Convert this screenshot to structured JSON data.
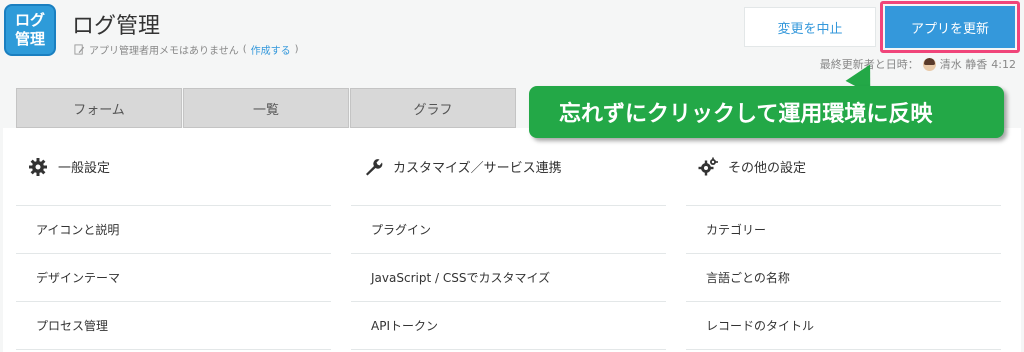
{
  "app": {
    "icon_line1": "ログ",
    "icon_line2": "管理",
    "title": "ログ管理"
  },
  "memo": {
    "text": "アプリ管理者用メモはありません",
    "link_open": "(",
    "link": "作成する",
    "link_close": ")"
  },
  "header": {
    "cancel_label": "変更を中止",
    "update_label": "アプリを更新",
    "last_updated_label": "最終更新者と日時：",
    "last_updated_user": "清水 静香",
    "last_updated_time": "4:12"
  },
  "tabs": [
    {
      "label": "フォーム"
    },
    {
      "label": "一覧"
    },
    {
      "label": "グラフ"
    }
  ],
  "callout": {
    "text": "忘れずにクリックして運用環境に反映"
  },
  "columns": [
    {
      "icon": "gear-icon",
      "title": "一般設定",
      "items": [
        "アイコンと説明",
        "デザインテーマ",
        "プロセス管理"
      ]
    },
    {
      "icon": "wrench-icon",
      "title": "カスタマイズ／サービス連携",
      "items": [
        "プラグイン",
        "JavaScript / CSSでカスタマイズ",
        "APIトークン"
      ]
    },
    {
      "icon": "gears-icon",
      "title": "その他の設定",
      "items": [
        "カテゴリー",
        "言語ごとの名称",
        "レコードのタイトル"
      ]
    }
  ],
  "colors": {
    "accent": "#3498db",
    "highlight_border": "#f0457a",
    "callout": "#23a847"
  }
}
